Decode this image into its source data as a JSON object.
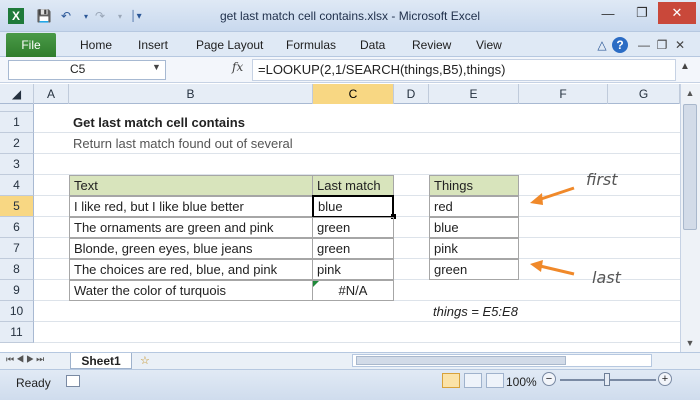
{
  "window": {
    "title": "get last match cell contains.xlsx  -  Microsoft Excel"
  },
  "qat": {
    "icons": [
      "excel-icon",
      "save-icon",
      "undo-icon",
      "redo-icon",
      "customize-icon"
    ]
  },
  "ribbon": {
    "file_label": "File",
    "tabs": [
      "Home",
      "Insert",
      "Page Layout",
      "Formulas",
      "Data",
      "Review",
      "View"
    ]
  },
  "formula_bar": {
    "name_box": "C5",
    "fx_label": "fx",
    "formula": "=LOOKUP(2,1/SEARCH(things,B5),things)"
  },
  "columns": [
    "A",
    "B",
    "C",
    "D",
    "E",
    "F",
    "G"
  ],
  "selected_column": "C",
  "rows": [
    "1",
    "2",
    "3",
    "4",
    "5",
    "6",
    "7",
    "8",
    "9",
    "10",
    "11"
  ],
  "selected_row": "5",
  "sheet": {
    "title": "Get last match cell contains",
    "subtitle": "Return last match found out of several",
    "headers": {
      "text": "Text",
      "last_match": "Last match",
      "things": "Things"
    },
    "data": [
      {
        "text": "I like red, but I like blue better",
        "last_match": "blue"
      },
      {
        "text": "The ornaments are green and pink",
        "last_match": "green"
      },
      {
        "text": "Blonde, green eyes, blue jeans",
        "last_match": "green"
      },
      {
        "text": "The choices are red, blue, and pink",
        "last_match": "pink"
      },
      {
        "text": "Water the color of turquois",
        "last_match": "#N/A"
      }
    ],
    "things": [
      "red",
      "blue",
      "pink",
      "green"
    ],
    "named_range": "things = E5:E8",
    "annotations": {
      "first": "first",
      "last": "last"
    },
    "colors": {
      "header_fill": "#d8e4bc",
      "accent_arrow": "#f0892a",
      "selection": "#000000"
    }
  },
  "sheet_tabs": {
    "active": "Sheet1"
  },
  "status": {
    "ready": "Ready",
    "zoom": "100%"
  }
}
